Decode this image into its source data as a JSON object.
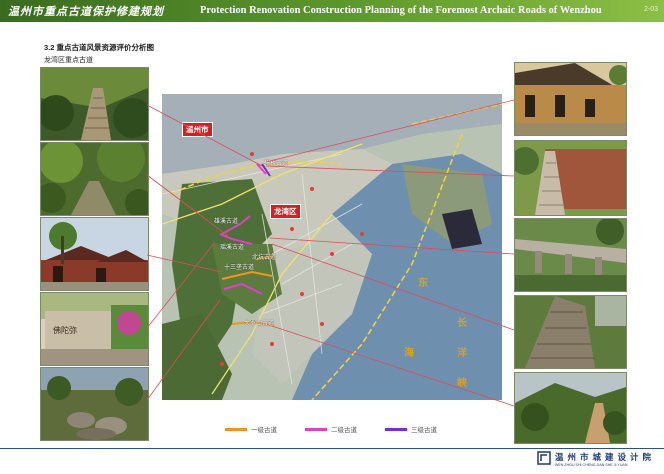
{
  "header": {
    "title_cn": "温州市重点古道保护修建规划",
    "title_en": "Protection Renovation Construction Planning of the Foremost Archaic Roads of Wenzhou",
    "page_no": "2-03"
  },
  "section": {
    "title": "3.2  重点古道风景资源评价分析图",
    "subtitle": "龙湾区重点古道"
  },
  "map": {
    "tags": [
      "温州市",
      "龙湾区"
    ],
    "sea_chars": [
      "东",
      "海",
      "长",
      "洋",
      "峡"
    ],
    "road_labels": [
      "碧桥古道",
      "雄溪古道",
      "瑶溪古道",
      "十三垄古道",
      "北坑古道",
      "大罗山古道"
    ]
  },
  "legend": {
    "items": [
      {
        "label": "一级古道",
        "color": "#f0961e"
      },
      {
        "label": "二级古道",
        "color": "#e040c8"
      },
      {
        "label": "三级古道",
        "color": "#7a2ad8"
      }
    ]
  },
  "footer": {
    "org_cn": "温州市城建设计院",
    "org_pinyin": "WEN ZHOU SHI CHENG JIAN SHE JI YUAN"
  },
  "colors": {
    "header_green": "#3a6b1f",
    "sea": "#6f8faf",
    "red_tag": "#d32020",
    "leader_red": "#e04a5a",
    "footer_blue": "#1e3a78"
  }
}
